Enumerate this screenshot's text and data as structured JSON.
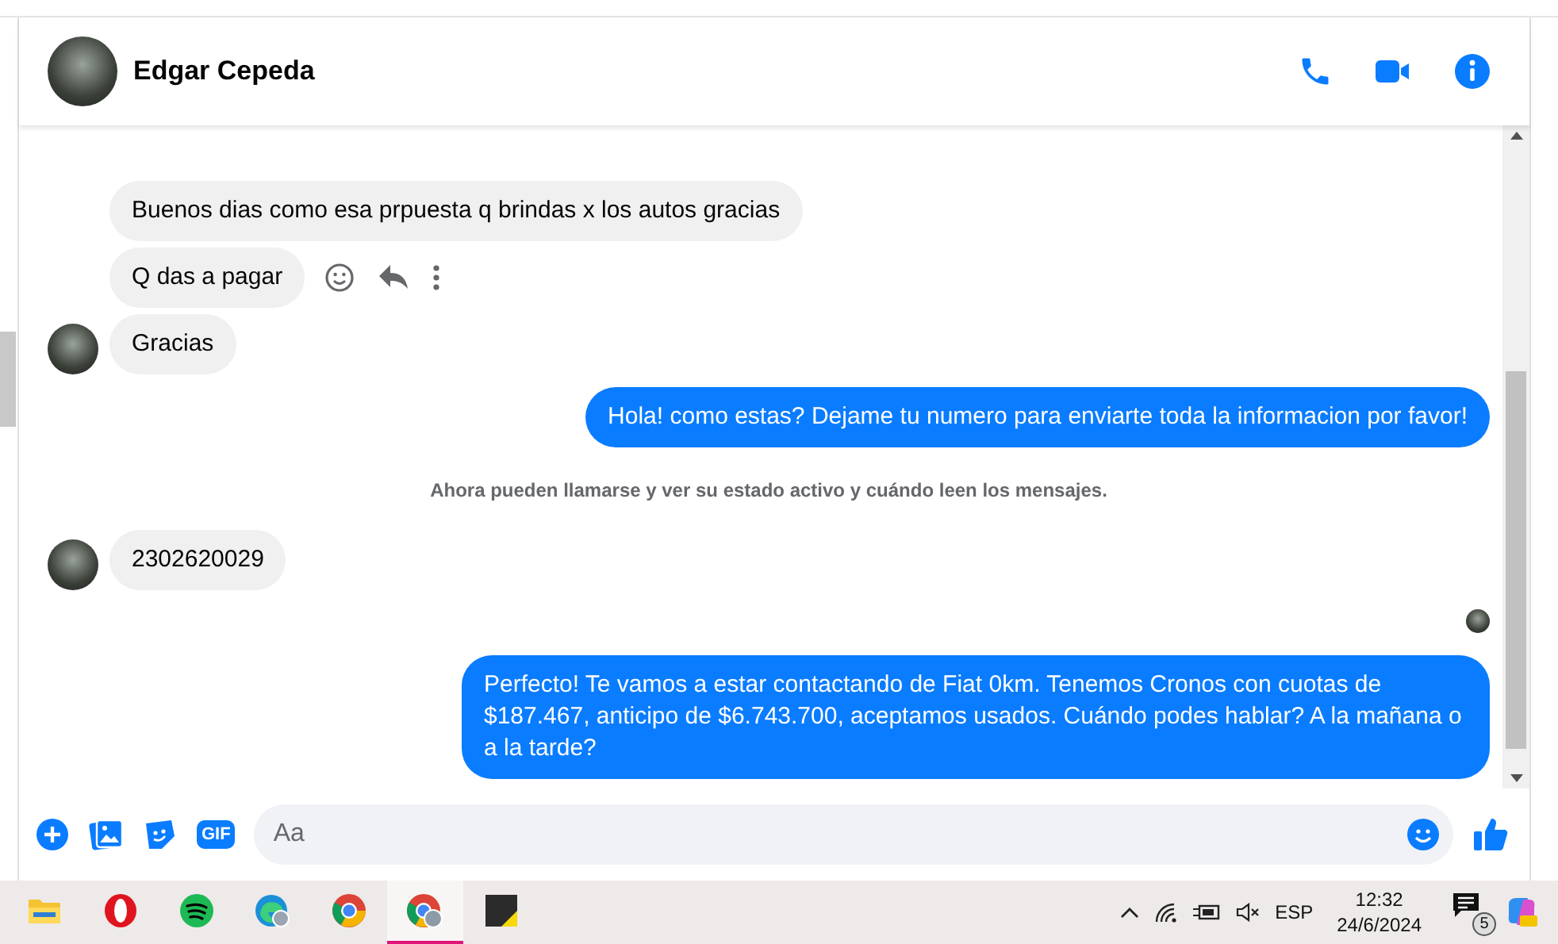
{
  "header": {
    "name": "Edgar Cepeda"
  },
  "messages": [
    {
      "kind": "in",
      "text": "Buenos dias como esa prpuesta q brindas x los autos gracias",
      "avatar": false,
      "actions": false
    },
    {
      "kind": "in",
      "text": "Q das a pagar",
      "avatar": false,
      "actions": true
    },
    {
      "kind": "in",
      "text": "Gracias",
      "avatar": true,
      "actions": false
    },
    {
      "kind": "out",
      "text": "Hola! como estas? Dejame tu numero para enviarte toda la informacion por favor!"
    },
    {
      "kind": "notice",
      "text": "Ahora pueden llamarse y ver su estado activo y cuándo leen los mensajes."
    },
    {
      "kind": "in",
      "text": "2302620029",
      "avatar": true,
      "actions": false
    },
    {
      "kind": "seen"
    },
    {
      "kind": "out",
      "text": "Perfecto! Te vamos a estar contactando de Fiat 0km. Tenemos Cronos con cuotas de $187.467, anticipo de $6.743.700, aceptamos usados. Cuándo podes hablar? A la mañana o a la tarde?"
    }
  ],
  "composer": {
    "gif": "GIF",
    "placeholder": "Aa"
  },
  "taskbar": {
    "apps": [
      {
        "kind": "files",
        "selected": false
      },
      {
        "kind": "opera",
        "selected": false
      },
      {
        "kind": "spotify",
        "selected": false
      },
      {
        "kind": "edge",
        "selected": false
      },
      {
        "kind": "chrome",
        "selected": false
      },
      {
        "kind": "chrome-profile",
        "selected": true
      },
      {
        "kind": "notes",
        "selected": false
      }
    ],
    "language": "ESP",
    "time": "12:32",
    "date": "24/6/2024",
    "notifications": "5"
  }
}
